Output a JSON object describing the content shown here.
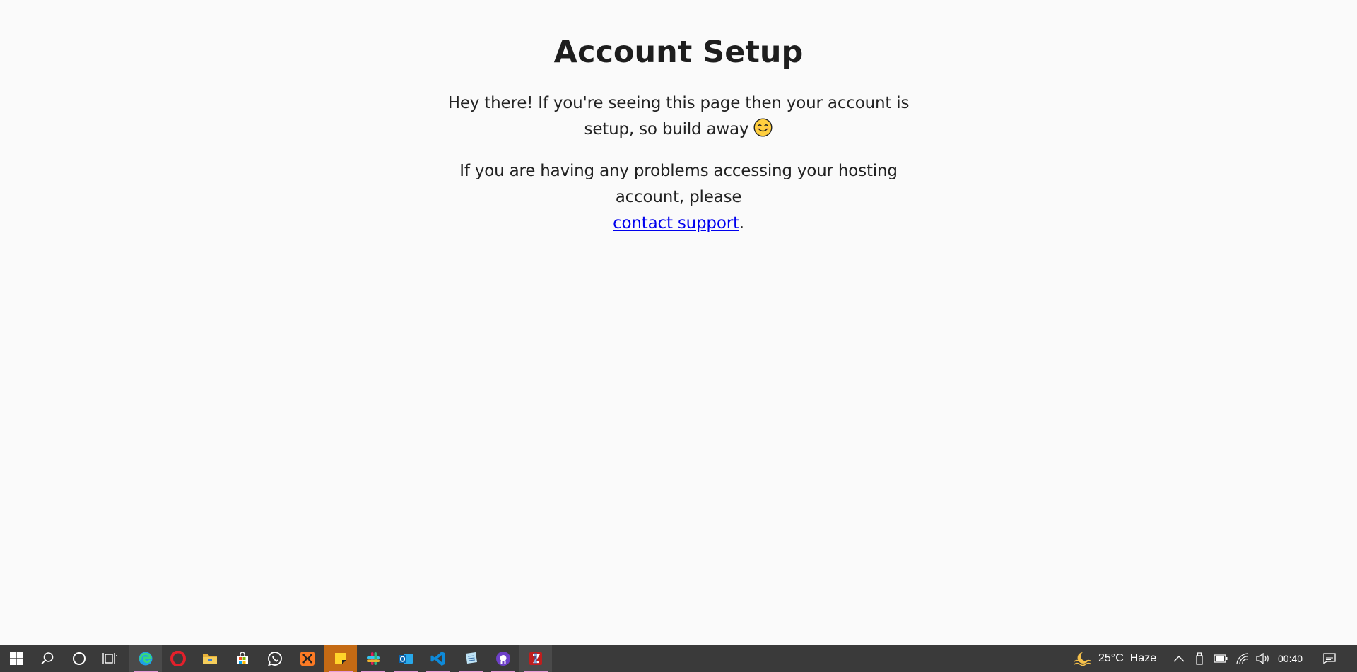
{
  "page": {
    "title": "Account Setup",
    "intro": "Hey there! If you're seeing this page then your account is setup, so build away",
    "problems_prefix": "If you are having any problems accessing your hosting account, please",
    "support_link": "contact support",
    "problems_suffix": "."
  },
  "taskbar": {
    "icons": [
      "windows-start-icon",
      "search-icon",
      "cortana-icon",
      "task-view-icon",
      "edge-icon",
      "opera-icon",
      "file-explorer-icon",
      "microsoft-store-icon",
      "whatsapp-icon",
      "xampp-icon",
      "sticky-notes-icon",
      "slack-icon",
      "outlook-icon",
      "vscode-icon",
      "notepad-icon",
      "github-desktop-icon",
      "filezilla-icon"
    ],
    "weather": {
      "temperature": "25°C",
      "condition": "Haze"
    },
    "clock": "00:40",
    "colors": {
      "background": "#3a3a3a",
      "running_indicator": "#e89ad8",
      "active_app": "#c46a14"
    }
  }
}
